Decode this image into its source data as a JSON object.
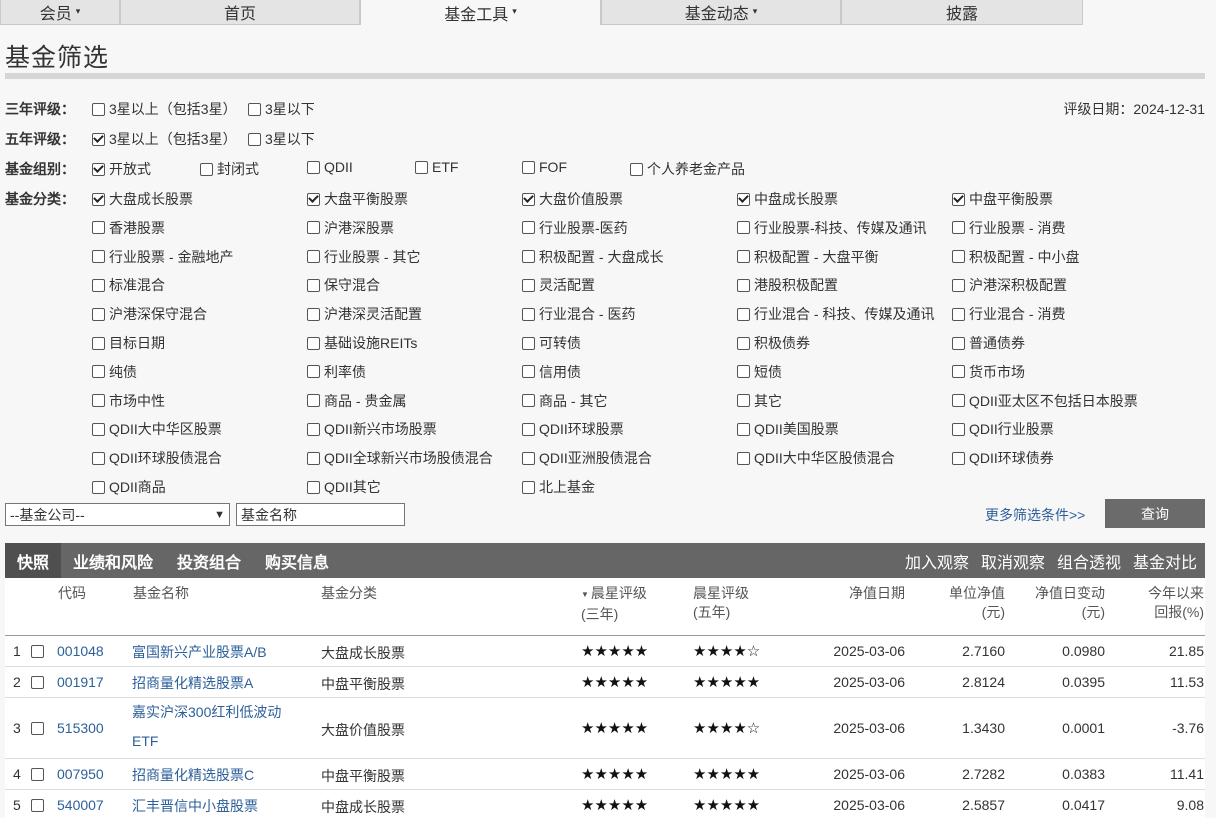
{
  "nav": [
    {
      "label": "会员",
      "dropdown": true
    },
    {
      "label": "首页",
      "dropdown": false
    },
    {
      "label": "基金工具",
      "dropdown": true,
      "active": true
    },
    {
      "label": "基金动态",
      "dropdown": true
    },
    {
      "label": "披露",
      "dropdown": false
    }
  ],
  "title": "基金筛选",
  "rating_date": "评级日期：2024-12-31",
  "filters": {
    "three_year": {
      "label": "三年评级：",
      "options": [
        {
          "text": "3星以上（包括3星）",
          "checked": false
        },
        {
          "text": "3星以下",
          "checked": false
        }
      ]
    },
    "five_year": {
      "label": "五年评级：",
      "options": [
        {
          "text": "3星以上（包括3星）",
          "checked": true
        },
        {
          "text": "3星以下",
          "checked": false
        }
      ]
    },
    "group": {
      "label": "基金组别：",
      "options": [
        {
          "text": "开放式",
          "checked": true
        },
        {
          "text": "封闭式",
          "checked": false
        },
        {
          "text": "QDII",
          "checked": false
        },
        {
          "text": "ETF",
          "checked": false
        },
        {
          "text": "FOF",
          "checked": false
        },
        {
          "text": "个人养老金产品",
          "checked": false
        }
      ]
    },
    "category": {
      "label": "基金分类：",
      "options": [
        {
          "text": "大盘成长股票",
          "checked": true
        },
        {
          "text": "大盘平衡股票",
          "checked": true
        },
        {
          "text": "大盘价值股票",
          "checked": true
        },
        {
          "text": "中盘成长股票",
          "checked": true
        },
        {
          "text": "中盘平衡股票",
          "checked": true
        },
        {
          "text": "香港股票",
          "checked": false
        },
        {
          "text": "沪港深股票",
          "checked": false
        },
        {
          "text": "行业股票-医药",
          "checked": false
        },
        {
          "text": "行业股票-科技、传媒及通讯",
          "checked": false
        },
        {
          "text": "行业股票 - 消费",
          "checked": false
        },
        {
          "text": "行业股票 - 金融地产",
          "checked": false
        },
        {
          "text": "行业股票 - 其它",
          "checked": false
        },
        {
          "text": "积极配置 - 大盘成长",
          "checked": false
        },
        {
          "text": "积极配置 - 大盘平衡",
          "checked": false
        },
        {
          "text": "积极配置 - 中小盘",
          "checked": false
        },
        {
          "text": "标准混合",
          "checked": false
        },
        {
          "text": "保守混合",
          "checked": false
        },
        {
          "text": "灵活配置",
          "checked": false
        },
        {
          "text": "港股积极配置",
          "checked": false
        },
        {
          "text": "沪港深积极配置",
          "checked": false
        },
        {
          "text": "沪港深保守混合",
          "checked": false
        },
        {
          "text": "沪港深灵活配置",
          "checked": false
        },
        {
          "text": "行业混合 - 医药",
          "checked": false
        },
        {
          "text": "行业混合 - 科技、传媒及通讯",
          "checked": false
        },
        {
          "text": "行业混合 - 消费",
          "checked": false
        },
        {
          "text": "目标日期",
          "checked": false
        },
        {
          "text": "基础设施REITs",
          "checked": false
        },
        {
          "text": "可转债",
          "checked": false
        },
        {
          "text": "积极债券",
          "checked": false
        },
        {
          "text": "普通债券",
          "checked": false
        },
        {
          "text": "纯债",
          "checked": false
        },
        {
          "text": "利率债",
          "checked": false
        },
        {
          "text": "信用债",
          "checked": false
        },
        {
          "text": "短债",
          "checked": false
        },
        {
          "text": "货币市场",
          "checked": false
        },
        {
          "text": "市场中性",
          "checked": false
        },
        {
          "text": "商品 - 贵金属",
          "checked": false
        },
        {
          "text": "商品 - 其它",
          "checked": false
        },
        {
          "text": "其它",
          "checked": false
        },
        {
          "text": "QDII亚太区不包括日本股票",
          "checked": false
        },
        {
          "text": "QDII大中华区股票",
          "checked": false
        },
        {
          "text": "QDII新兴市场股票",
          "checked": false
        },
        {
          "text": "QDII环球股票",
          "checked": false
        },
        {
          "text": "QDII美国股票",
          "checked": false
        },
        {
          "text": "QDII行业股票",
          "checked": false
        },
        {
          "text": "QDII环球股债混合",
          "checked": false
        },
        {
          "text": "QDII全球新兴市场股债混合",
          "checked": false
        },
        {
          "text": "QDII亚洲股债混合",
          "checked": false
        },
        {
          "text": "QDII大中华区股债混合",
          "checked": false
        },
        {
          "text": "QDII环球债券",
          "checked": false
        },
        {
          "text": "QDII商品",
          "checked": false
        },
        {
          "text": "QDII其它",
          "checked": false
        },
        {
          "text": "北上基金",
          "checked": false
        }
      ]
    }
  },
  "search": {
    "company_selected": "--基金公司--",
    "name_placeholder": "基金名称",
    "more_link": "更多筛选条件>>",
    "query_button": "查询"
  },
  "result_tabs": [
    {
      "label": "快照",
      "active": true
    },
    {
      "label": "业绩和风险"
    },
    {
      "label": "投资组合"
    },
    {
      "label": "购买信息"
    }
  ],
  "result_actions": [
    "加入观察",
    "取消观察",
    "组合透视",
    "基金对比"
  ],
  "table": {
    "headers": {
      "code": "代码",
      "name": "基金名称",
      "category": "基金分类",
      "rating3_a": "晨星评级",
      "rating3_b": "(三年)",
      "rating5_a": "晨星评级",
      "rating5_b": "(五年)",
      "nav_date": "净值日期",
      "unit_nav_a": "单位净值",
      "unit_nav_b": "(元)",
      "daily_change_a": "净值日变动",
      "daily_change_b": "(元)",
      "ytd_a": "今年以来",
      "ytd_b": "回报(%)"
    },
    "rows": [
      {
        "idx": "1",
        "code": "001048",
        "name": "富国新兴产业股票A/B",
        "category": "大盘成长股票",
        "stars3": 5,
        "stars5": 4,
        "date": "2025-03-06",
        "nav": "2.7160",
        "change": "0.0980",
        "ytd": "21.85"
      },
      {
        "idx": "2",
        "code": "001917",
        "name": "招商量化精选股票A",
        "category": "中盘平衡股票",
        "stars3": 5,
        "stars5": 5,
        "date": "2025-03-06",
        "nav": "2.8124",
        "change": "0.0395",
        "ytd": "11.53"
      },
      {
        "idx": "3",
        "code": "515300",
        "name": "嘉实沪深300红利低波动",
        "name2": "ETF",
        "category": "大盘价值股票",
        "stars3": 5,
        "stars5": 4,
        "date": "2025-03-06",
        "nav": "1.3430",
        "change": "0.0001",
        "ytd": "-3.76"
      },
      {
        "idx": "4",
        "code": "007950",
        "name": "招商量化精选股票C",
        "category": "中盘平衡股票",
        "stars3": 5,
        "stars5": 5,
        "date": "2025-03-06",
        "nav": "2.7282",
        "change": "0.0383",
        "ytd": "11.41"
      },
      {
        "idx": "5",
        "code": "540007",
        "name": "汇丰晋信中小盘股票",
        "category": "中盘成长股票",
        "stars3": 5,
        "stars5": 5,
        "date": "2025-03-06",
        "nav": "2.5857",
        "change": "0.0417",
        "ytd": "9.08"
      }
    ]
  }
}
